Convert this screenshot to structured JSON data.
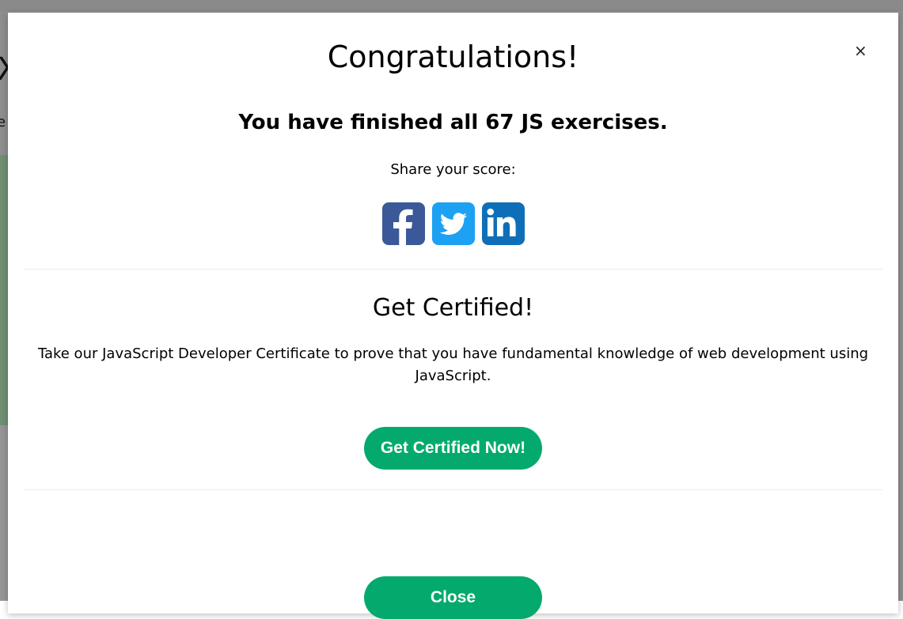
{
  "modal": {
    "close_symbol": "×",
    "title": "Congratulations!",
    "subtitle": "You have finished all 67 JS exercises.",
    "share_label": "Share your score:",
    "social": [
      {
        "name": "facebook",
        "icon": "facebook-icon",
        "color": "#3b5998"
      },
      {
        "name": "twitter",
        "icon": "twitter-icon",
        "color": "#1da1f2"
      },
      {
        "name": "linkedin",
        "icon": "linkedin-icon",
        "color": "#0077b5"
      }
    ],
    "cert_title": "Get Certified!",
    "cert_text": "Take our JavaScript Developer Certificate to prove that you have fundamental knowledge of web development using JavaScript.",
    "cert_button": "Get Certified Now!",
    "close_button": "Close"
  },
  "background": {
    "peek_char_1": "X",
    "peek_char_2": "e"
  },
  "colors": {
    "accent": "#04aa6d",
    "overlay": "#8e8e8e"
  }
}
